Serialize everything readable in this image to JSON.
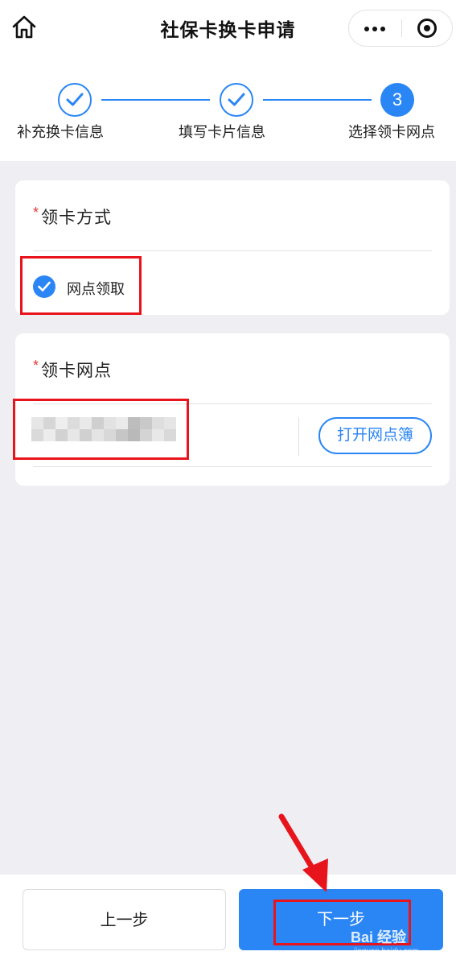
{
  "header": {
    "title": "社保卡换卡申请",
    "home_icon": "home-icon",
    "more_icon": "more-dots-icon",
    "close_icon": "target-close-icon"
  },
  "stepper": {
    "steps": [
      {
        "label": "补充换卡信息",
        "status": "done"
      },
      {
        "label": "填写卡片信息",
        "status": "done"
      },
      {
        "label": "选择领卡网点",
        "status": "active",
        "number": "3"
      }
    ],
    "accent": "#2b86f5"
  },
  "pickup_method": {
    "required_mark": "*",
    "title": "领卡方式",
    "option_label": "网点领取",
    "option_checked": true
  },
  "pickup_outlet": {
    "required_mark": "*",
    "title": "领卡网点",
    "outlet_value_obscured": true,
    "open_book_button": "打开网点簿"
  },
  "bottom": {
    "prev_label": "上一步",
    "next_label": "下一步"
  },
  "watermark": {
    "text": "Bai 经验",
    "sub": "jingyan.baidu.com"
  },
  "colors": {
    "accent": "#2b86f5",
    "required": "#e53935",
    "annotation": "#e8141c",
    "background": "#eeeef3"
  }
}
